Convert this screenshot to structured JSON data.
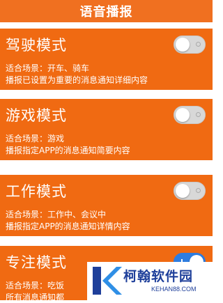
{
  "header": {
    "title": "语音播报"
  },
  "modes": [
    {
      "title": "驾驶模式",
      "scene": "适合场景：开车、骑车",
      "desc": "播报已设置为重要的消息通知详细内容",
      "enabled": false
    },
    {
      "title": "游戏模式",
      "scene": "适合场景：游戏",
      "desc": "播报指定APP的消息通知简要内容",
      "enabled": false
    },
    {
      "title": "工作模式",
      "scene": "适合场景：工作中、会议中",
      "desc": "播报指定APP的消息通知详情内容",
      "enabled": false
    },
    {
      "title": "专注模式",
      "scene": "适合场景：吃饭",
      "desc": "所有消息通知都",
      "enabled": true
    }
  ],
  "watermark": {
    "name": "柯翰软件园",
    "url": "KEHAN88.COM"
  },
  "colors": {
    "accent": "#f06a12",
    "toggle_on": "#2e7de0"
  }
}
